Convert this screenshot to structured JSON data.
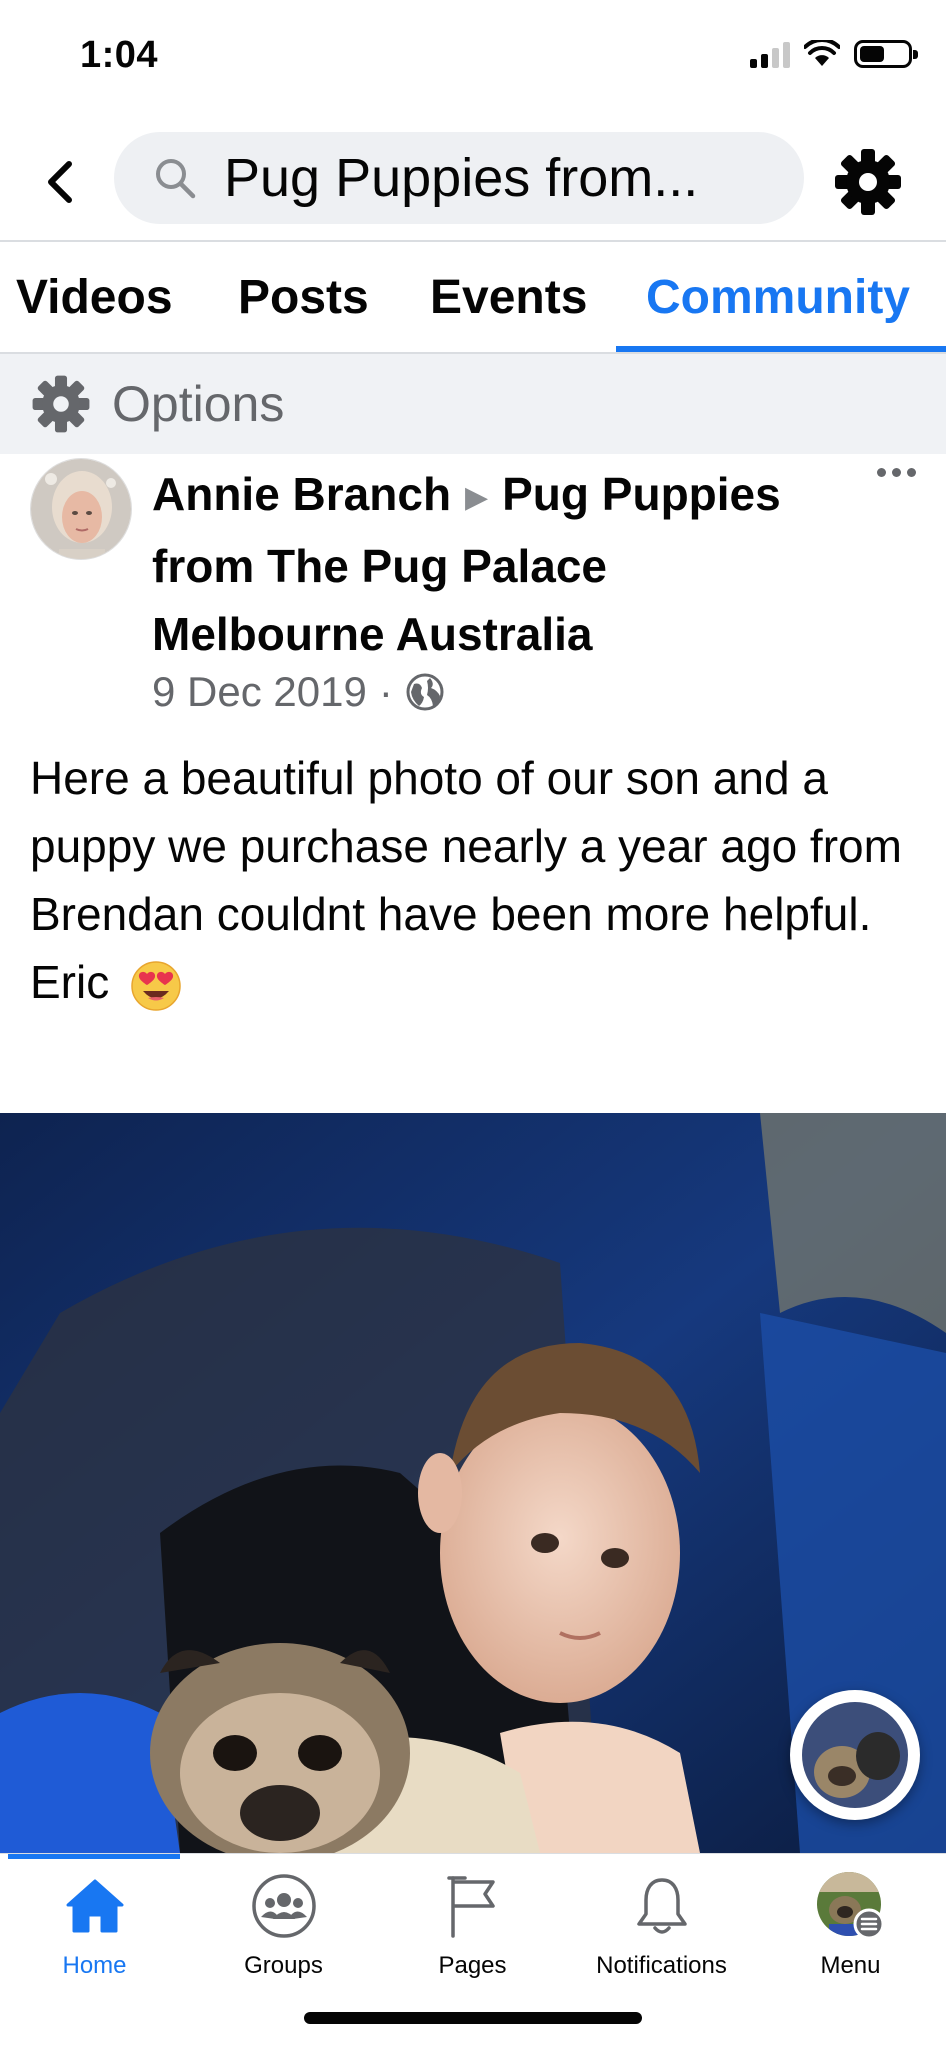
{
  "status_bar": {
    "time": "1:04"
  },
  "header": {
    "search_query": "Pug Puppies from..."
  },
  "tabs": [
    {
      "label": "Videos"
    },
    {
      "label": "Posts"
    },
    {
      "label": "Events"
    },
    {
      "label": "Community",
      "active": true
    }
  ],
  "options": {
    "label": "Options"
  },
  "post": {
    "author": "Annie Branch",
    "group": "Pug Puppies from The Pug Palace Melbourne Australia",
    "date": "9 Dec 2019",
    "separator": "·",
    "text": "Here a beautiful photo of our son and a puppy we purchase nearly a year ago from Brendan couldnt have been more helpful.",
    "signature": "Eric"
  },
  "bottom_nav": [
    {
      "label": "Home",
      "icon": "home-icon",
      "active": true
    },
    {
      "label": "Groups",
      "icon": "groups-icon"
    },
    {
      "label": "Pages",
      "icon": "pages-flag-icon"
    },
    {
      "label": "Notifications",
      "icon": "bell-icon"
    },
    {
      "label": "Menu",
      "icon": "profile-menu-icon"
    }
  ],
  "colors": {
    "accent": "#1877f2",
    "secondary_text": "#65676b",
    "options_bg": "#f0f2f5"
  }
}
